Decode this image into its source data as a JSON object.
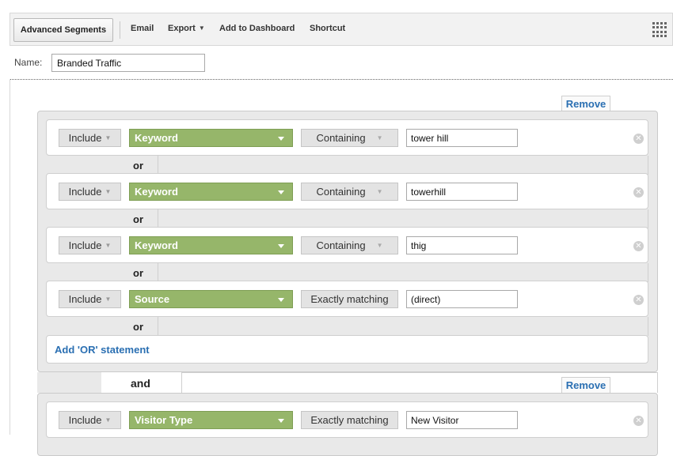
{
  "toolbar": {
    "advanced_segments": "Advanced Segments",
    "email": "Email",
    "export": "Export",
    "add_to_dashboard": "Add to Dashboard",
    "shortcut": "Shortcut",
    "apps_icon": "grid-icon"
  },
  "name_field": {
    "label": "Name:",
    "value": "Branded Traffic"
  },
  "remove_label": "Remove",
  "or_label": "or",
  "and_label": "and",
  "add_or_label": "Add 'OR' statement",
  "groups": [
    {
      "conditions": [
        {
          "include": "Include",
          "dimension": "Keyword",
          "match": "Containing",
          "value": "tower hill"
        },
        {
          "include": "Include",
          "dimension": "Keyword",
          "match": "Containing",
          "value": "towerhill"
        },
        {
          "include": "Include",
          "dimension": "Keyword",
          "match": "Containing",
          "value": "thig"
        },
        {
          "include": "Include",
          "dimension": "Source",
          "match": "Exactly matching",
          "value": "(direct)"
        }
      ]
    },
    {
      "conditions": [
        {
          "include": "Include",
          "dimension": "Visitor Type",
          "match": "Exactly matching",
          "value": "New Visitor"
        }
      ]
    }
  ],
  "colors": {
    "dimension_bg": "#96b66a",
    "link_blue": "#2a6fb2",
    "group_bg": "#e9e9e9"
  }
}
